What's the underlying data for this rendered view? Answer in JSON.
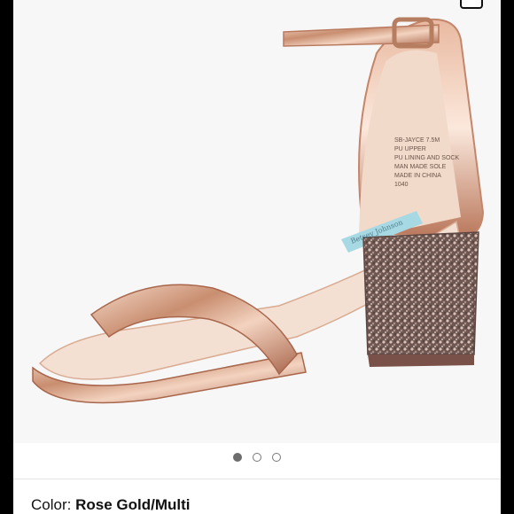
{
  "gallery": {
    "image_alt": "Rose gold metallic ankle-strap sandal with glitter block heel",
    "insole_label_text": "SB-JAYCE 7.5M\nPU UPPER\nPU LINING AND SOCK\nMAN MADE SOLE\nMADE IN CHINA\n1040",
    "insole_brand_text": "Betsey Johnson",
    "dots_total": 3,
    "dots_active_index": 0
  },
  "product": {
    "color_label": "Color:",
    "color_value": "Rose Gold/Multi"
  },
  "colors": {
    "rose_gold": "#d7a98a",
    "glitter": "#8a6f67",
    "sky_blue": "#a7d9e4"
  }
}
